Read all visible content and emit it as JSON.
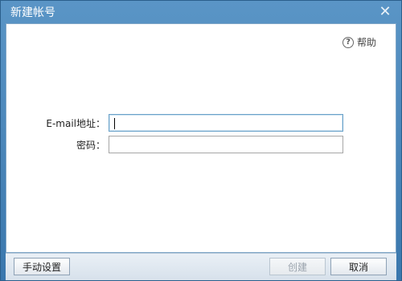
{
  "window": {
    "title": "新建帐号",
    "close_symbol": "✕"
  },
  "help": {
    "label": "帮助",
    "icon": "question-circle-icon"
  },
  "form": {
    "email": {
      "label": "E-mail地址：",
      "value": "",
      "placeholder": ""
    },
    "password": {
      "label": "密码：",
      "value": "",
      "placeholder": ""
    }
  },
  "footer": {
    "manual_label": "手动设置",
    "create_label": "创建",
    "cancel_label": "取消"
  },
  "colors": {
    "titlebar": "#4a88bd",
    "accent": "#6aa2c9"
  }
}
